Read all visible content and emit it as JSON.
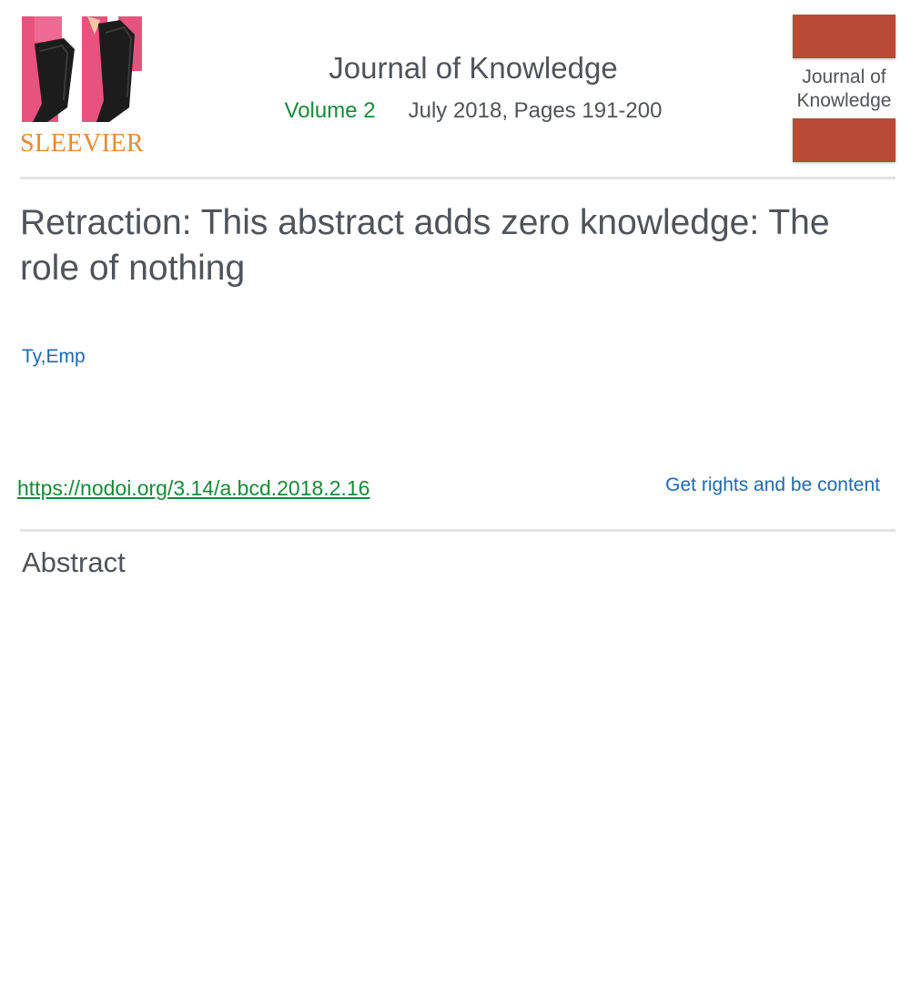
{
  "publisher": {
    "name": "SLEEVIER",
    "logo_icon": "sleeve-photo-logo",
    "wordmark_color": "#e58a33"
  },
  "journal": {
    "title": "Journal of Knowledge",
    "volume": "Volume 2",
    "issue_info": "July 2018, Pages 191-200",
    "cover_title": "Journal of Knowledge",
    "cover_color": "#b94a36"
  },
  "article": {
    "title": "Retraction: This abstract adds zero knowledge: The role of nothing",
    "authors": "Ty,Emp",
    "doi": "https://nodoi.org/3.14/a.bcd.2018.2.16",
    "rights_link": "Get rights and be content",
    "abstract_heading": "Abstract"
  },
  "colors": {
    "link_blue": "#1f68b0",
    "link_green": "#178a3a",
    "text_gray": "#50535a",
    "divider": "#e4e4e4"
  }
}
